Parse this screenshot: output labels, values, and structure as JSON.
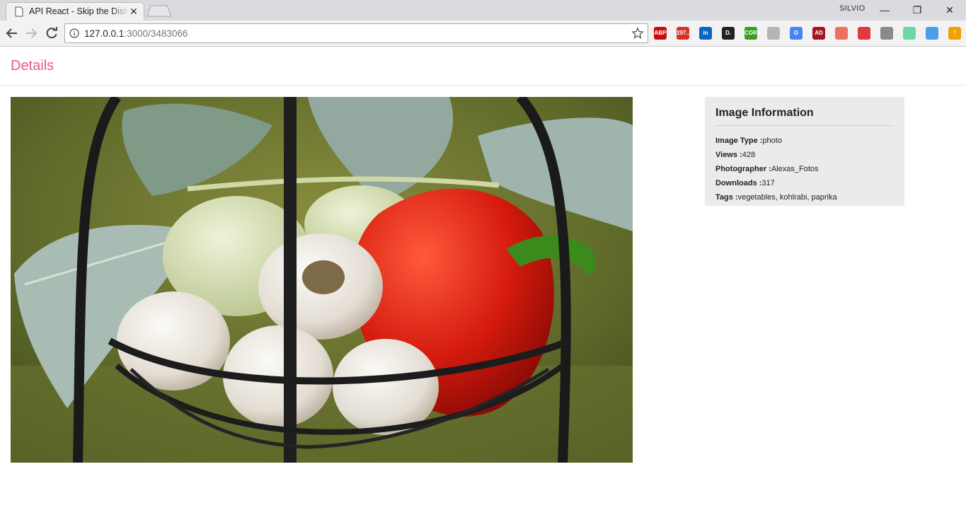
{
  "browser": {
    "tab_title": "API React - Skip the Dishes",
    "profile_name": "SILVIO",
    "url_host": "127.0.0.1",
    "url_path": ":3000/3483066",
    "extensions": [
      {
        "name": "abp-icon",
        "text": "ABP",
        "color": "#c70d0d"
      },
      {
        "name": "gmail-icon",
        "text": "297...",
        "color": "#d93025"
      },
      {
        "name": "linkedin-icon",
        "text": "in",
        "color": "#0a66c2"
      },
      {
        "name": "d-icon",
        "text": "D.",
        "color": "#222222"
      },
      {
        "name": "cors-icon",
        "text": "CORS",
        "color": "#3b9b22"
      },
      {
        "name": "pdf-icon",
        "text": "",
        "color": "#b5b5b5"
      },
      {
        "name": "translate-icon",
        "text": "G",
        "color": "#4a84f4"
      },
      {
        "name": "adblock-icon",
        "text": "AD",
        "color": "#a5151d"
      },
      {
        "name": "circle-icon",
        "text": "",
        "color": "#f07060"
      },
      {
        "name": "refresh-red-icon",
        "text": "",
        "color": "#e0393e"
      },
      {
        "name": "shield-icon",
        "text": "",
        "color": "#8a8a8a"
      },
      {
        "name": "ring-icon",
        "text": "",
        "color": "#6dd6a5"
      },
      {
        "name": "sync-icon",
        "text": "",
        "color": "#4aa0e8"
      },
      {
        "name": "alert-icon",
        "text": "!",
        "color": "#f0a000"
      }
    ]
  },
  "page": {
    "brand": "Details",
    "image_alt": "vegetables, kohlrabi, paprika"
  },
  "info": {
    "title": "Image Information",
    "rows": [
      {
        "label": "Image Type :",
        "value": "photo"
      },
      {
        "label": "Views :",
        "value": "428"
      },
      {
        "label": "Photographer :",
        "value": "Alexas_Fotos"
      },
      {
        "label": "Downloads :",
        "value": "317"
      },
      {
        "label": "Tags :",
        "value": "vegetables, kohlrabi, paprika"
      }
    ]
  }
}
